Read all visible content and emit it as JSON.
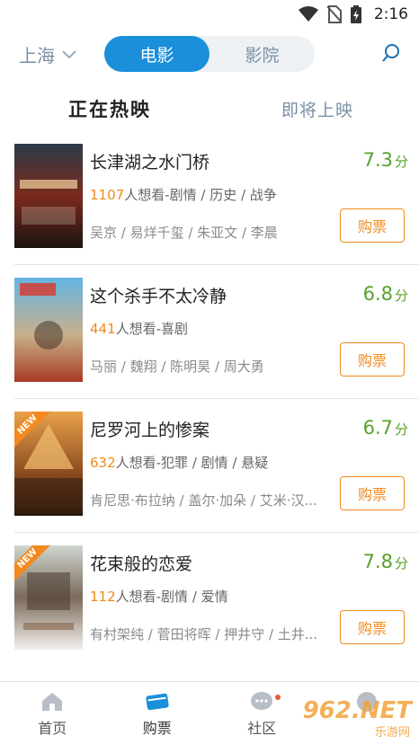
{
  "status_bar": {
    "time": "2:16",
    "icons": [
      "wifi-icon",
      "no-sim-icon",
      "battery-charging-icon"
    ]
  },
  "header": {
    "city": "上海",
    "segments": [
      "电影",
      "影院"
    ],
    "active_segment": "电影",
    "search_icon": "search-icon"
  },
  "tabs": {
    "active": "正在热映",
    "inactive": "即将上映"
  },
  "movies": [
    {
      "title": "长津湖之水门桥",
      "score": "7.3",
      "score_unit": "分",
      "want_count": "1107",
      "want_text": "人想看-剧情 / 历史 / 战争",
      "cast": "吴京 / 易烊千玺 / 朱亚文 / 李晨",
      "buy_label": "购票",
      "is_new": false,
      "poster_colors": [
        "#7a2a1c",
        "#3a1d16"
      ]
    },
    {
      "title": "这个杀手不太冷静",
      "score": "6.8",
      "score_unit": "分",
      "want_count": "441",
      "want_text": "人想看-喜剧",
      "cast": "马丽 / 魏翔 / 陈明昊 / 周大勇",
      "buy_label": "购票",
      "is_new": false,
      "poster_colors": [
        "#4aa3d6",
        "#c44a2a"
      ]
    },
    {
      "title": "尼罗河上的惨案",
      "score": "6.7",
      "score_unit": "分",
      "want_count": "632",
      "want_text": "人想看-犯罪 / 剧情 / 悬疑",
      "cast": "肯尼思·布拉纳 / 盖尔·加朵 / 艾米·汉...",
      "buy_label": "购票",
      "is_new": true,
      "new_label": "NEW",
      "poster_colors": [
        "#d98a3a",
        "#4a2a14"
      ]
    },
    {
      "title": "花束般的恋爱",
      "score": "7.8",
      "score_unit": "分",
      "want_count": "112",
      "want_text": "人想看-剧情 / 爱情",
      "cast": "有村架纯 / 菅田将晖 / 押井守 / 土井...",
      "buy_label": "购票",
      "is_new": true,
      "new_label": "NEW",
      "poster_colors": [
        "#e9e4dc",
        "#8c6f56"
      ]
    }
  ],
  "bottom_nav": [
    {
      "label": "首页",
      "icon": "home-icon"
    },
    {
      "label": "购票",
      "icon": "ticket-icon"
    },
    {
      "label": "社区",
      "icon": "chat-icon"
    },
    {
      "label": "",
      "icon": "profile-icon"
    }
  ],
  "watermark": {
    "brand": "962.NET",
    "sub": "乐游网"
  },
  "colors": {
    "accent_blue": "#1b8fd9",
    "score_green": "#58a02b",
    "orange": "#f08a1c"
  }
}
